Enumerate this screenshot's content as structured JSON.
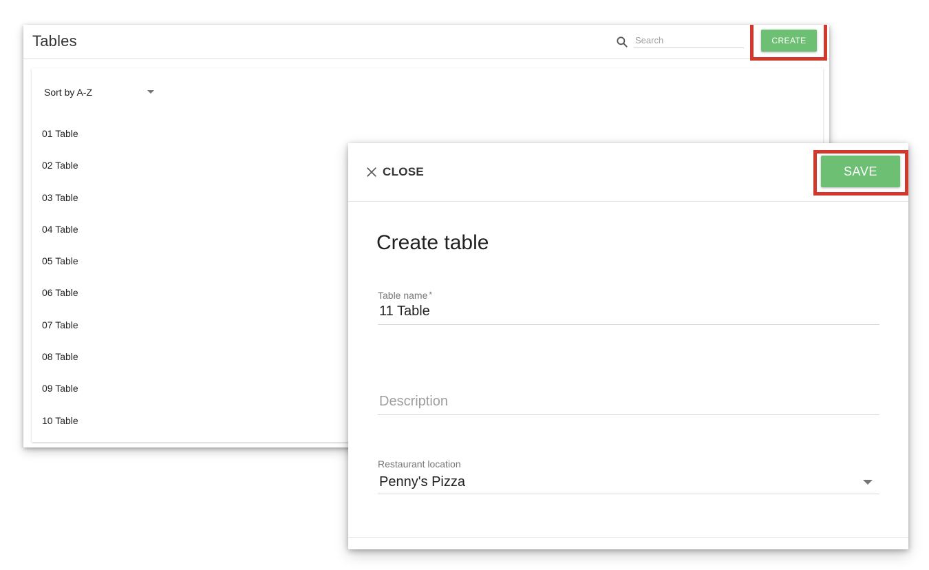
{
  "tables_window": {
    "title": "Tables",
    "search_placeholder": "Search",
    "create_label": "CREATE",
    "sort_label": "Sort by A-Z",
    "tables": [
      "01 Table",
      "02 Table",
      "03 Table",
      "04 Table",
      "05 Table",
      "06 Table",
      "07 Table",
      "08 Table",
      "09 Table",
      "10 Table"
    ]
  },
  "create_panel": {
    "close_label": "CLOSE",
    "save_label": "SAVE",
    "title": "Create table",
    "table_name_label": "Table name",
    "table_name_required": "*",
    "table_name_value": "11 Table",
    "description_placeholder": "Description",
    "location_label": "Restaurant location",
    "location_value": "Penny's Pizza"
  },
  "icons": {
    "search": "search-icon",
    "close": "close-icon",
    "dropdown": "chevron-down-icon"
  },
  "colors": {
    "accent_green": "#6dbf73",
    "highlight_red": "#d0392b"
  }
}
